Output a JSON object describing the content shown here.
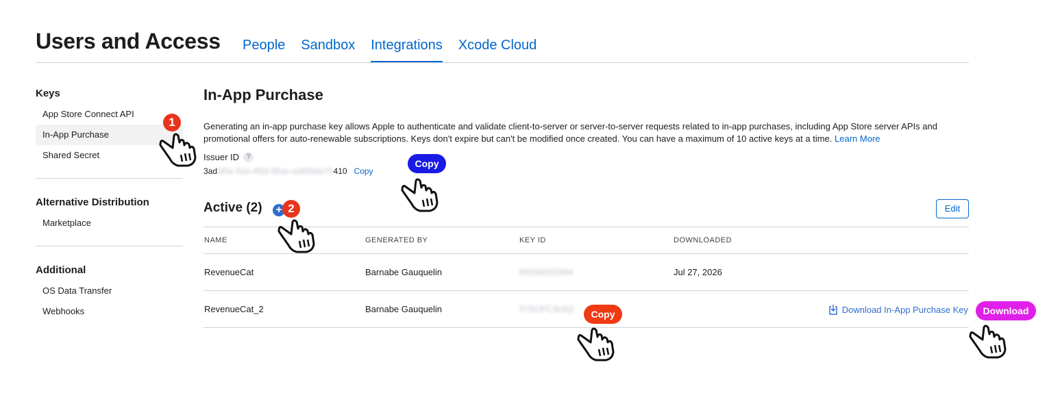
{
  "header": {
    "title": "Users and Access",
    "tabs": [
      {
        "label": "People"
      },
      {
        "label": "Sandbox"
      },
      {
        "label": "Integrations"
      },
      {
        "label": "Xcode Cloud"
      }
    ]
  },
  "sidebar": {
    "groups": [
      {
        "title": "Keys",
        "items": [
          "App Store Connect API",
          "In-App Purchase",
          "Shared Secret"
        ]
      },
      {
        "title": "Alternative Distribution",
        "items": [
          "Marketplace"
        ]
      },
      {
        "title": "Additional",
        "items": [
          "OS Data Transfer",
          "Webhooks"
        ]
      }
    ],
    "selected": "In-App Purchase"
  },
  "main": {
    "title": "In-App Purchase",
    "description": "Generating an in-app purchase key allows Apple to authenticate and validate client-to-server or server-to-server requests related to in-app purchases, including App Store server APIs and promotional offers for auto-renewable subscriptions. Keys don't expire but can't be modified once created. You can have a maximum of 10 active keys at a time.",
    "learn_more": "Learn More",
    "issuer": {
      "label": "Issuer ID",
      "help": "?",
      "value_prefix": "3ad",
      "value_hidden": "5f0e-5ed-4f5d-95ae-a385b8e75",
      "value_suffix": "410",
      "copy_label": "Copy"
    },
    "active": {
      "title": "Active (2)",
      "add_symbol": "+",
      "edit_label": "Edit"
    },
    "table": {
      "columns": [
        "NAME",
        "GENERATED BY",
        "KEY ID",
        "DOWNLOADED"
      ],
      "rows": [
        {
          "name": "RevenueCat",
          "generated_by": "Barnabe Gauquelin",
          "key_id": "R5S8325D84",
          "downloaded": "Jul 27, 2026",
          "action": ""
        },
        {
          "name": "RevenueCat_2",
          "generated_by": "Barnabe Gauquelin",
          "key_id": "575CFC3U5Z",
          "downloaded": "",
          "action": "Download In-App Purchase Key"
        }
      ]
    }
  },
  "annotations": {
    "step1": "1",
    "step2": "2",
    "copy_issuer": "Copy",
    "copy_key": "Copy",
    "download": "Download",
    "colors": {
      "step": "#e8341c",
      "copy_issuer": "#1a1ae6",
      "copy_key": "#f03a14",
      "download": "#e020e8",
      "link": "#0066cc"
    }
  }
}
